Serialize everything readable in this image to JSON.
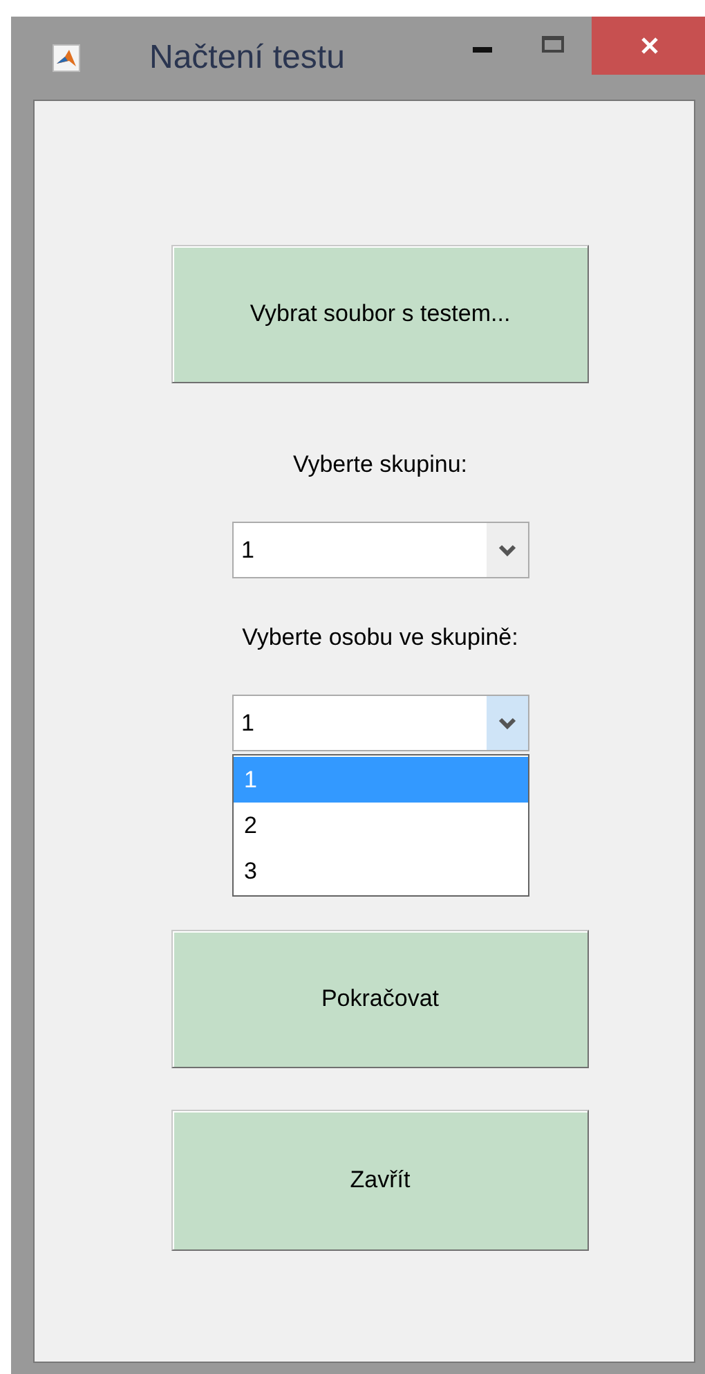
{
  "window": {
    "title": "Načtení testu"
  },
  "file_button": {
    "label": "Vybrat soubor s testem..."
  },
  "group_select": {
    "label": "Vyberte skupinu:",
    "value": "1",
    "expanded": false
  },
  "person_select": {
    "label": "Vyberte osobu ve skupině:",
    "value": "1",
    "expanded": true,
    "options": [
      {
        "label": "1",
        "selected": true
      },
      {
        "label": "2",
        "selected": false
      },
      {
        "label": "3",
        "selected": false
      }
    ]
  },
  "buttons": [
    "Pokračovat",
    "Zavřít"
  ]
}
